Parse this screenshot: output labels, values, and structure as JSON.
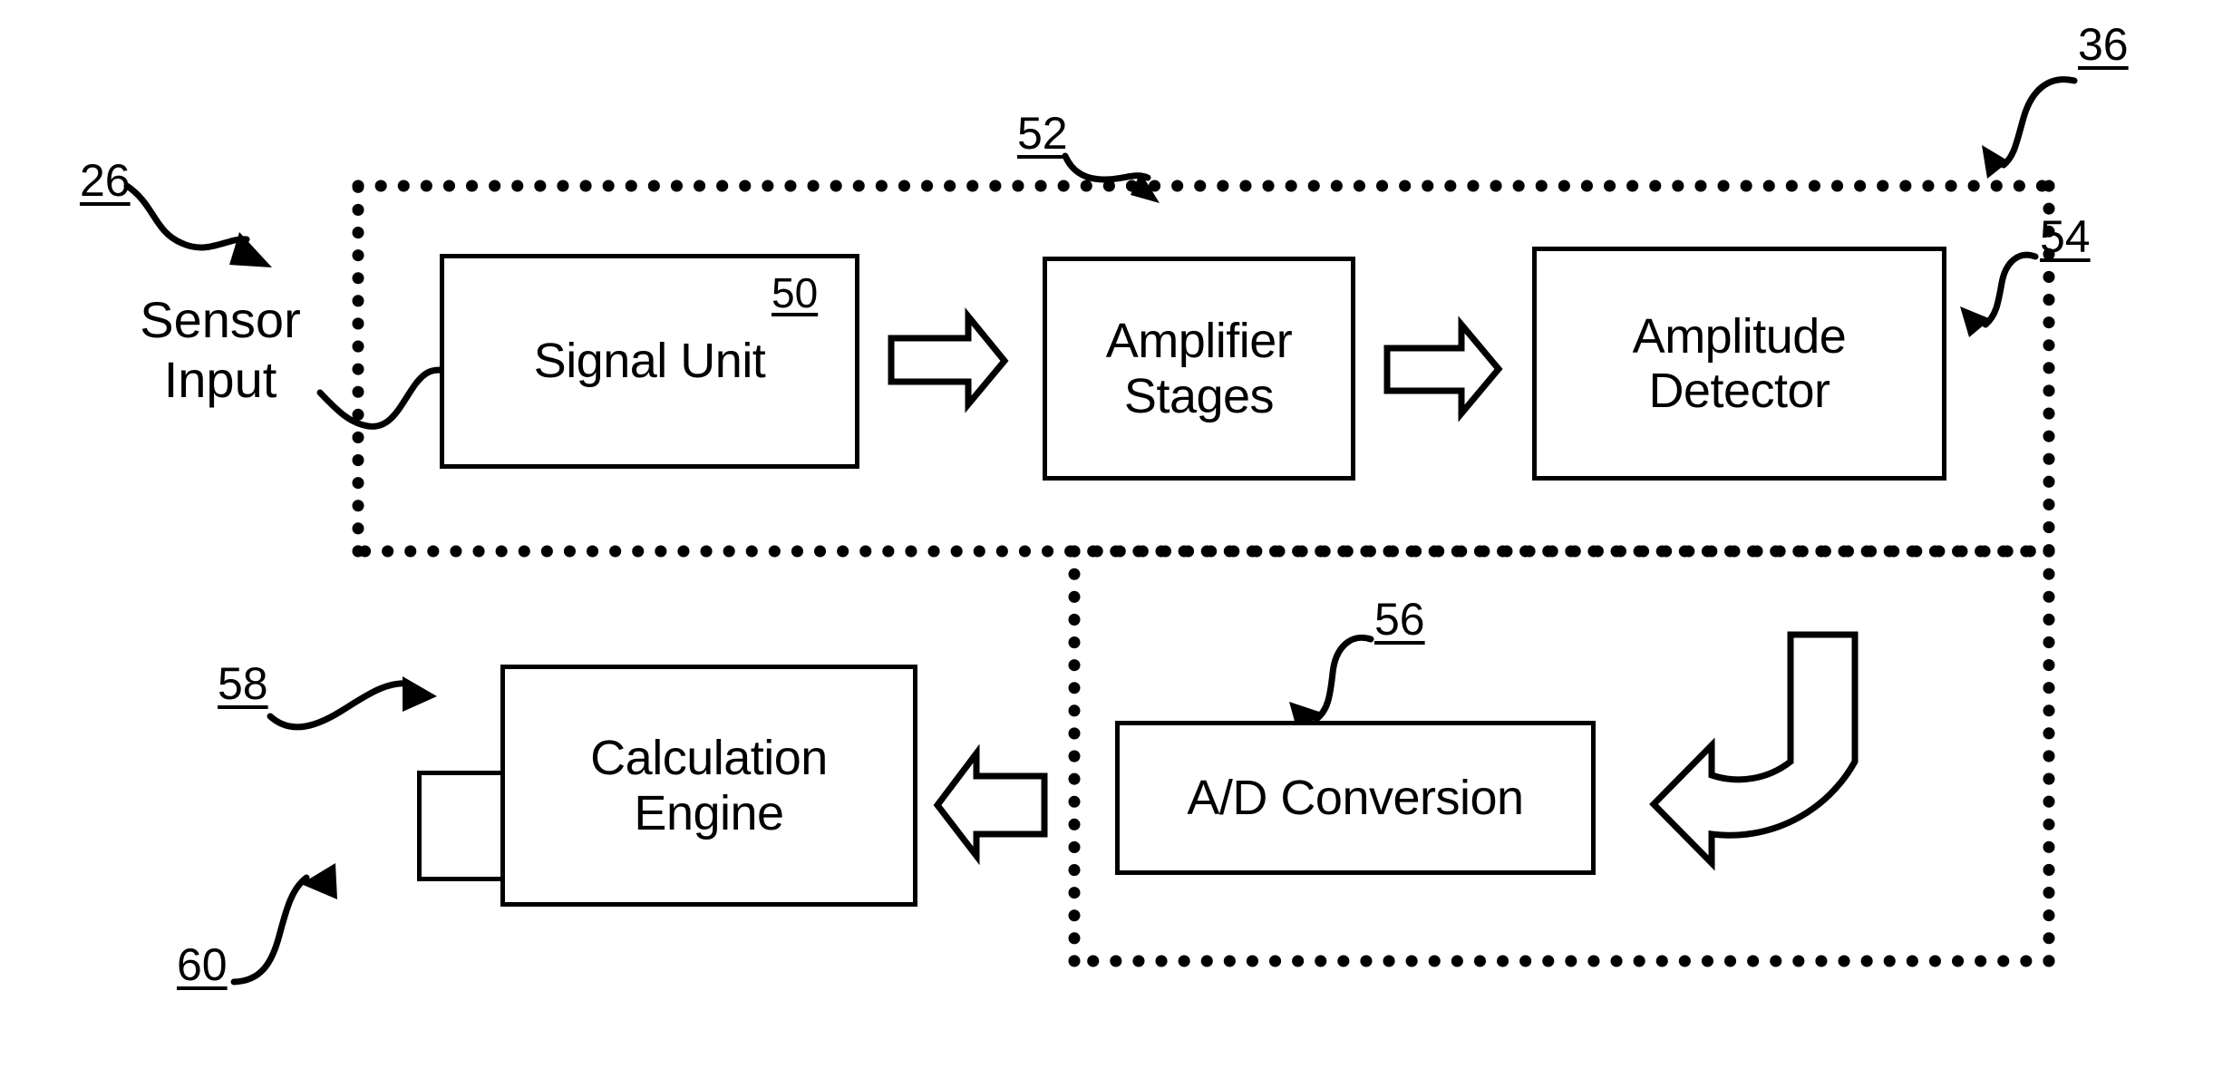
{
  "figure": {
    "title": "Sensor signal processing block diagram",
    "background_color": "#ffffff",
    "line_color": "#000000"
  },
  "free_labels": {
    "sensor_input": "Sensor\nInput"
  },
  "nodes": [
    {
      "id": "signal_unit",
      "label": "Signal Unit",
      "ref": "50"
    },
    {
      "id": "amplifier_stages",
      "label": "Amplifier\nStages",
      "ref": ""
    },
    {
      "id": "amplitude_detector",
      "label": "Amplitude\nDetector",
      "ref": ""
    },
    {
      "id": "ad_conversion",
      "label": "A/D Conversion",
      "ref": ""
    },
    {
      "id": "calculation_engine",
      "label": "Calculation\nEngine",
      "ref": ""
    }
  ],
  "reference_numerals": [
    {
      "id": "ref_26",
      "value": "26",
      "points_to": "sensor-input-text"
    },
    {
      "id": "ref_36",
      "value": "36",
      "points_to": "upper-dotted-enclosure"
    },
    {
      "id": "ref_52",
      "value": "52",
      "points_to": "upper-dotted-enclosure-edge"
    },
    {
      "id": "ref_54",
      "value": "54",
      "points_to": "right-dotted-edge"
    },
    {
      "id": "ref_50",
      "value": "50",
      "points_to": "signal-unit-box"
    },
    {
      "id": "ref_56",
      "value": "56",
      "points_to": "ad-conversion-box"
    },
    {
      "id": "ref_58",
      "value": "58",
      "points_to": "calculation-engine-box"
    },
    {
      "id": "ref_60",
      "value": "60",
      "points_to": "calculation-engine-subbox"
    }
  ],
  "enclosures": [
    {
      "id": "upper_dotted_box",
      "style": "dotted",
      "ref": "36"
    },
    {
      "id": "lower_dotted_box",
      "style": "dotted",
      "ref": ""
    }
  ],
  "connectors": [
    {
      "id": "conn_sensor_to_signal_unit",
      "type": "wire",
      "from": "sensor_input",
      "to": "signal_unit"
    },
    {
      "id": "conn_signal_to_amplifier",
      "type": "block-arrow",
      "from": "signal_unit",
      "to": "amplifier_stages",
      "direction": "right"
    },
    {
      "id": "conn_amplifier_to_detector",
      "type": "block-arrow",
      "from": "amplifier_stages",
      "to": "amplitude_detector",
      "direction": "right"
    },
    {
      "id": "conn_detector_to_ad",
      "type": "block-arrow",
      "from": "amplitude_detector",
      "to": "ad_conversion",
      "direction": "curved-down-left"
    },
    {
      "id": "conn_ad_to_calculation",
      "type": "block-arrow",
      "from": "ad_conversion",
      "to": "calculation_engine",
      "direction": "left"
    }
  ]
}
